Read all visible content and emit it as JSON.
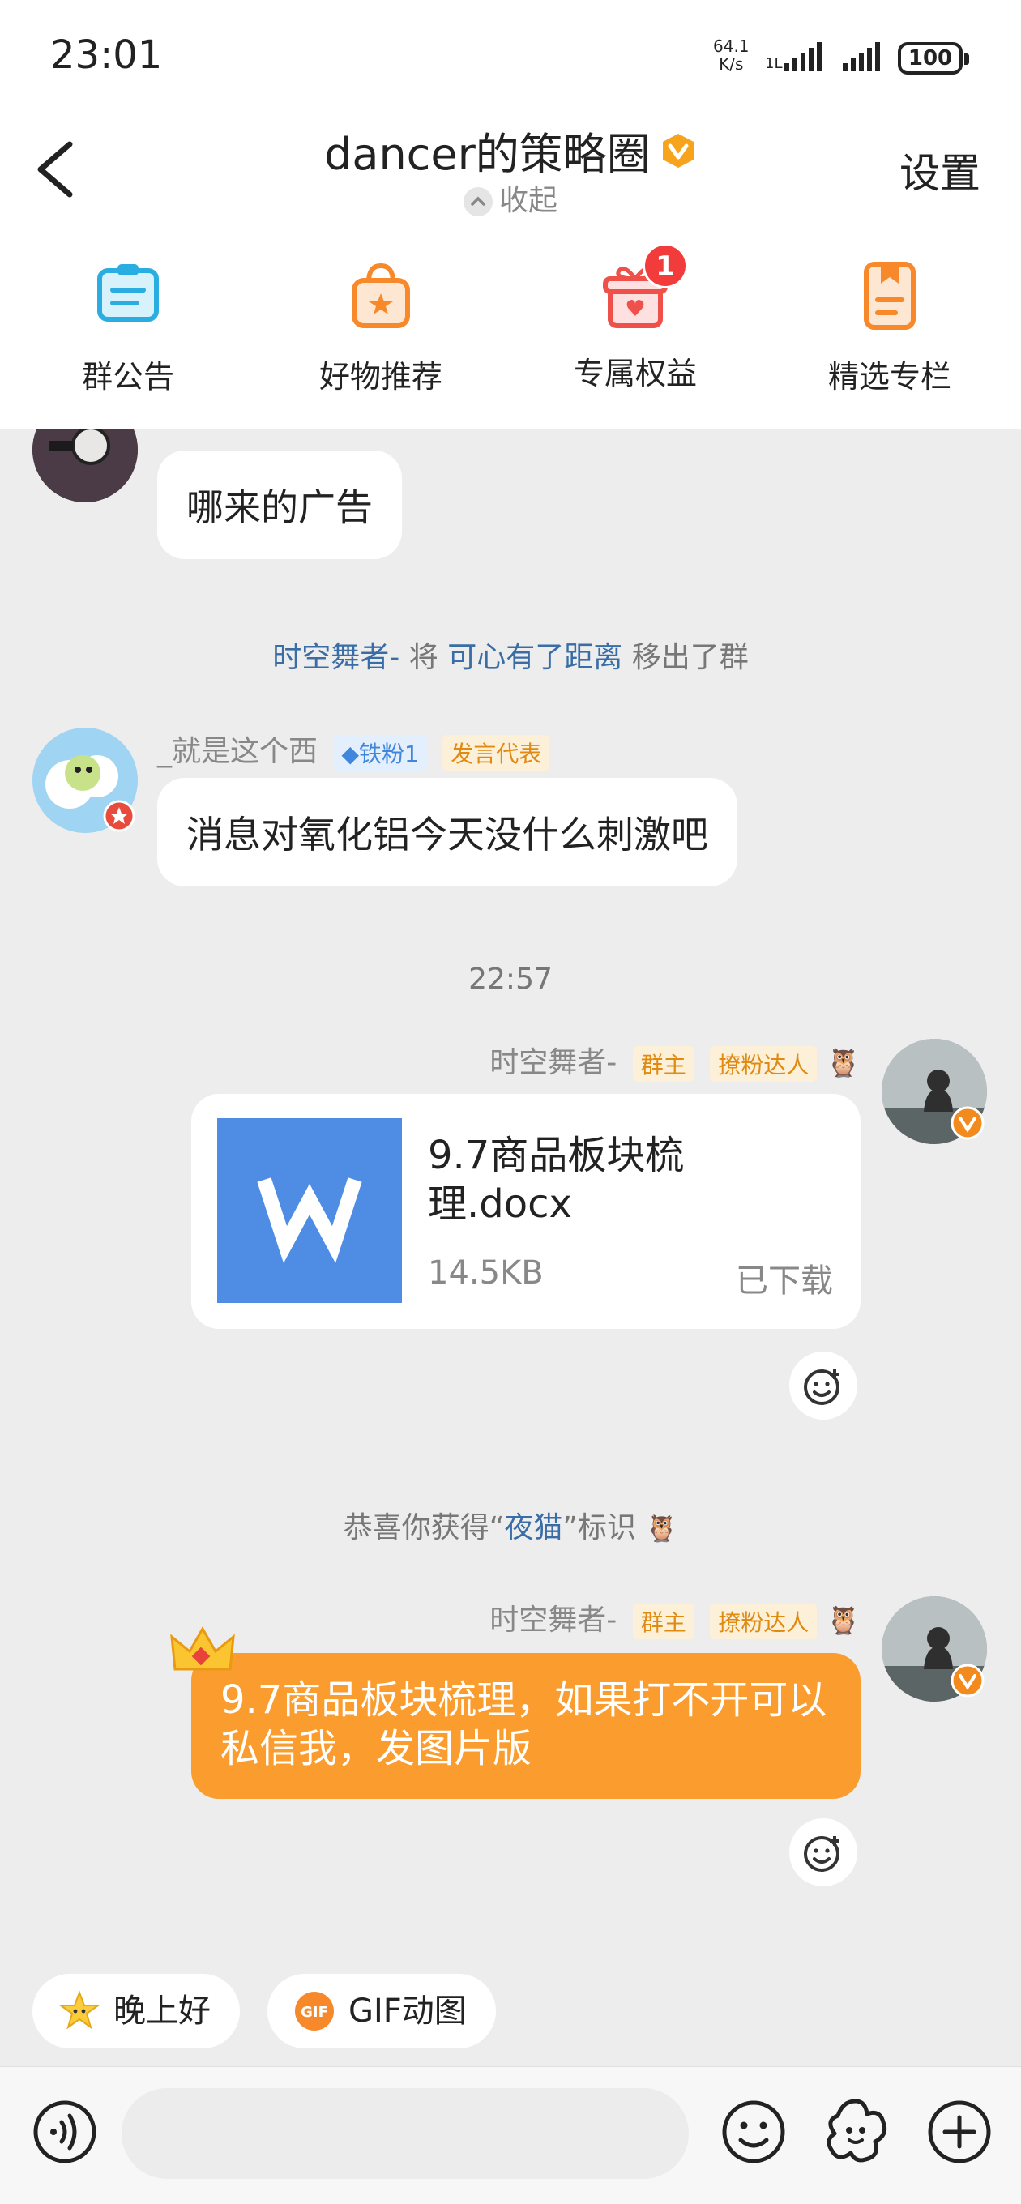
{
  "status_bar": {
    "time": "23:01",
    "net_speed_value": "64.1",
    "net_speed_unit": "K/s",
    "battery": "100"
  },
  "header": {
    "title": "dancer的策略圈",
    "collapse_label": "收起",
    "settings_label": "设置",
    "verified_color": "#f7a31c"
  },
  "quick_menu": [
    {
      "label": "群公告",
      "icon": "announcement-icon"
    },
    {
      "label": "好物推荐",
      "icon": "shopping-bag-icon"
    },
    {
      "label": "专属权益",
      "icon": "gift-box-icon",
      "badge": "1"
    },
    {
      "label": "精选专栏",
      "icon": "column-document-icon"
    }
  ],
  "chat": {
    "msg1_text": "哪来的广告",
    "sys1": {
      "actor": "时空舞者-",
      "verb": "将",
      "target": "可心有了距离",
      "action": "移出了群"
    },
    "msg2": {
      "nickname": "_就是这个西",
      "tag1": "铁粉1",
      "tag2": "发言代表",
      "text": "消息对氧化铝今天没什么刺激吧"
    },
    "timestamp": "22:57",
    "msg3": {
      "nickname": "时空舞者-",
      "tag1": "群主",
      "tag2": "撩粉达人",
      "file_name": "9.7商品板块梳理.docx",
      "file_size": "14.5KB",
      "file_status": "已下载"
    },
    "sys2": {
      "prefix": "恭喜你获得“",
      "highlight": "夜猫",
      "suffix": "”标识"
    },
    "msg4": {
      "nickname": "时空舞者-",
      "tag1": "群主",
      "tag2": "撩粉达人",
      "text": "9.7商品板块梳理，如果打不开可以私信我，发图片版"
    }
  },
  "quick_replies": [
    {
      "label": "晚上好",
      "icon": "star-emoji-icon"
    },
    {
      "label": "GIF动图",
      "icon": "gif-icon"
    }
  ],
  "input_bar": {
    "placeholder": ""
  },
  "colors": {
    "accent_orange": "#fb9c2e",
    "link_blue": "#3a6da6",
    "badge_red": "#f23b3b",
    "file_blue": "#4f8de4"
  }
}
